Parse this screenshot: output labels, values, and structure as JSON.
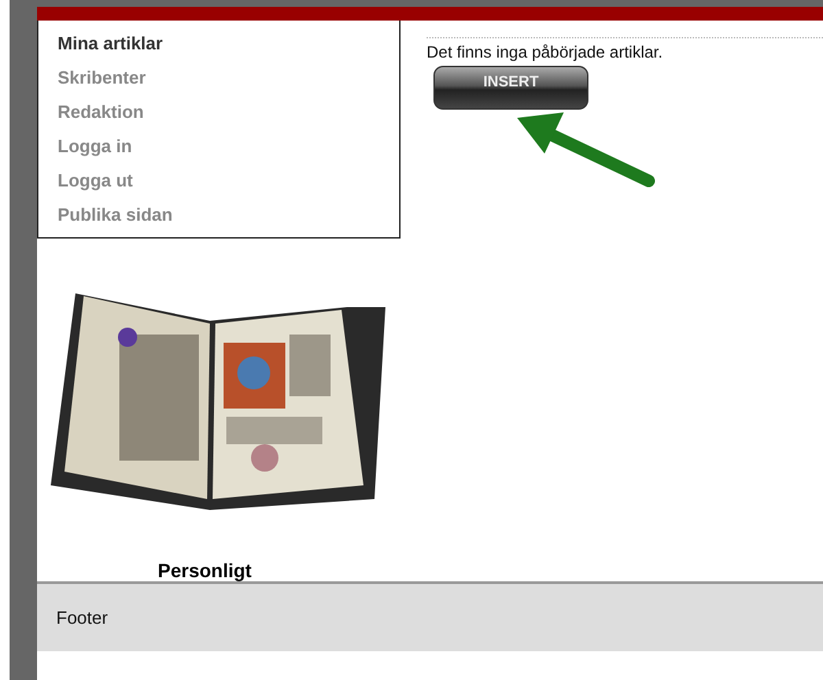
{
  "menu": {
    "items": [
      {
        "label": "Mina artiklar",
        "selected": true
      },
      {
        "label": "Skribenter",
        "selected": false
      },
      {
        "label": "Redaktion",
        "selected": false
      },
      {
        "label": "Logga in",
        "selected": false
      },
      {
        "label": "Logga ut",
        "selected": false
      },
      {
        "label": "Publika sidan",
        "selected": false
      }
    ]
  },
  "content": {
    "message": "Det finns inga påbörjade artiklar.",
    "button": "INSERT"
  },
  "sidebar": {
    "caption": "Personligt"
  },
  "footer": {
    "text": "Footer"
  }
}
